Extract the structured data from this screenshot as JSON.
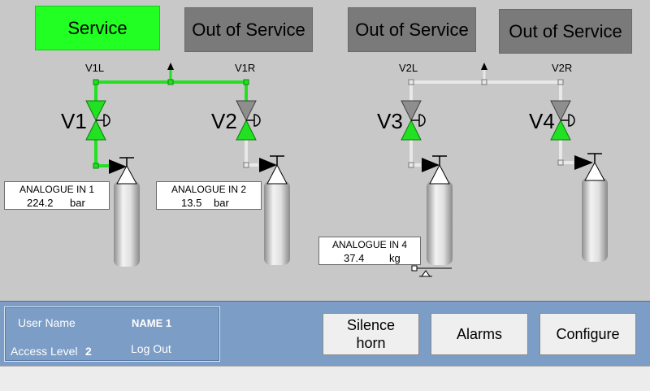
{
  "status_buttons": [
    {
      "label": "Service",
      "state": "on"
    },
    {
      "label": "Out of Service",
      "state": "off"
    },
    {
      "label": "Out of Service",
      "state": "off"
    },
    {
      "label": "Out of Service",
      "state": "off"
    }
  ],
  "valves": [
    {
      "name": "V1"
    },
    {
      "name": "V2"
    },
    {
      "name": "V3"
    },
    {
      "name": "V4"
    }
  ],
  "pipe_labels": {
    "v1l": "V1L",
    "v1r": "V1R",
    "v2l": "V2L",
    "v2r": "V2R"
  },
  "analogue": [
    {
      "title": "ANALOGUE  IN 1",
      "value": "224.2",
      "unit": "bar"
    },
    {
      "title": "ANALOGUE  IN 2",
      "value": "13.5",
      "unit": "bar"
    },
    {
      "title": "ANALOGUE IN 4",
      "value": "37.4",
      "unit": "kg"
    }
  ],
  "user": {
    "user_name_label": "User Name",
    "user_name": "NAME 1",
    "access_level_label": "Access Level",
    "access_level": "2",
    "logout": "Log Out"
  },
  "footer_buttons": {
    "silence": "Silence horn",
    "alarms": "Alarms",
    "configure": "Configure"
  },
  "colors": {
    "active": "#22ff22",
    "inactive": "#7a7a7a",
    "footer": "#7b9dc6"
  }
}
